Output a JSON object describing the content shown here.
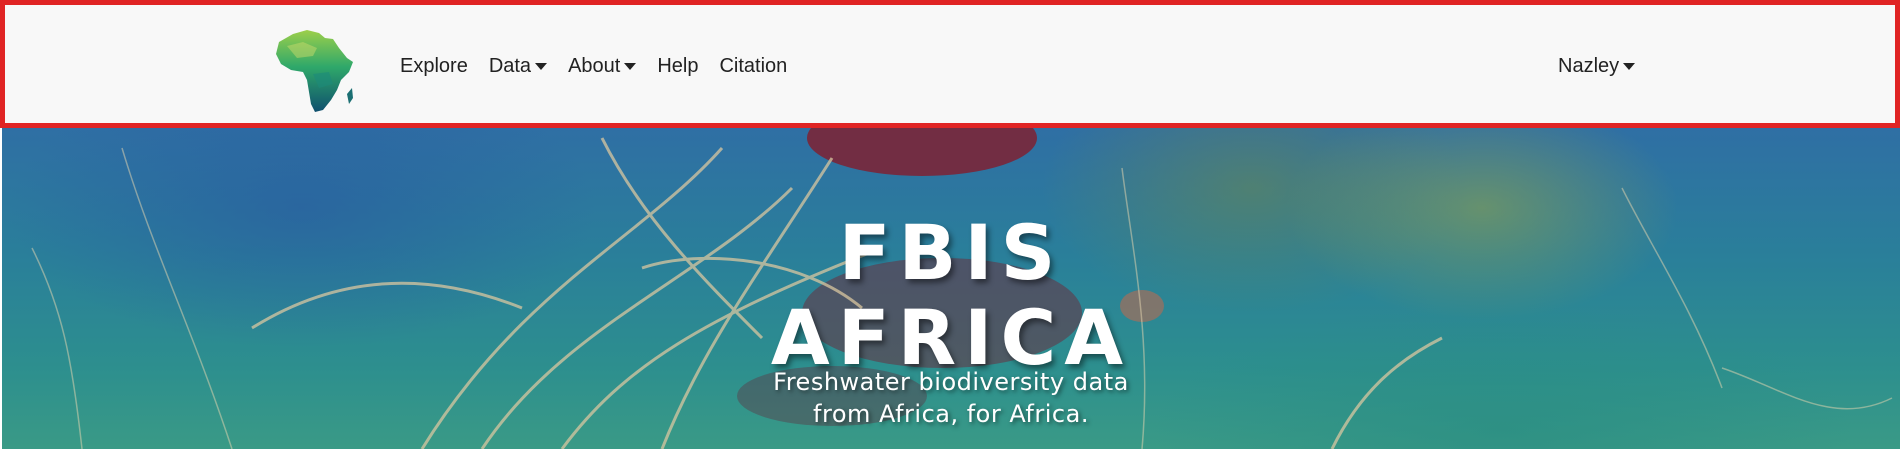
{
  "navbar": {
    "logo_icon": "africa-map-logo",
    "links": [
      {
        "label": "Explore",
        "has_dropdown": false
      },
      {
        "label": "Data",
        "has_dropdown": true
      },
      {
        "label": "About",
        "has_dropdown": true
      },
      {
        "label": "Help",
        "has_dropdown": false
      },
      {
        "label": "Citation",
        "has_dropdown": false
      }
    ],
    "user": {
      "label": "Nazley",
      "has_dropdown": true
    },
    "highlight_color": "#e02424"
  },
  "hero": {
    "title_line1": "FBIS",
    "title_line2": "AFRICA",
    "subtitle_line1": "Freshwater biodiversity data",
    "subtitle_line2": "from Africa, for Africa."
  }
}
